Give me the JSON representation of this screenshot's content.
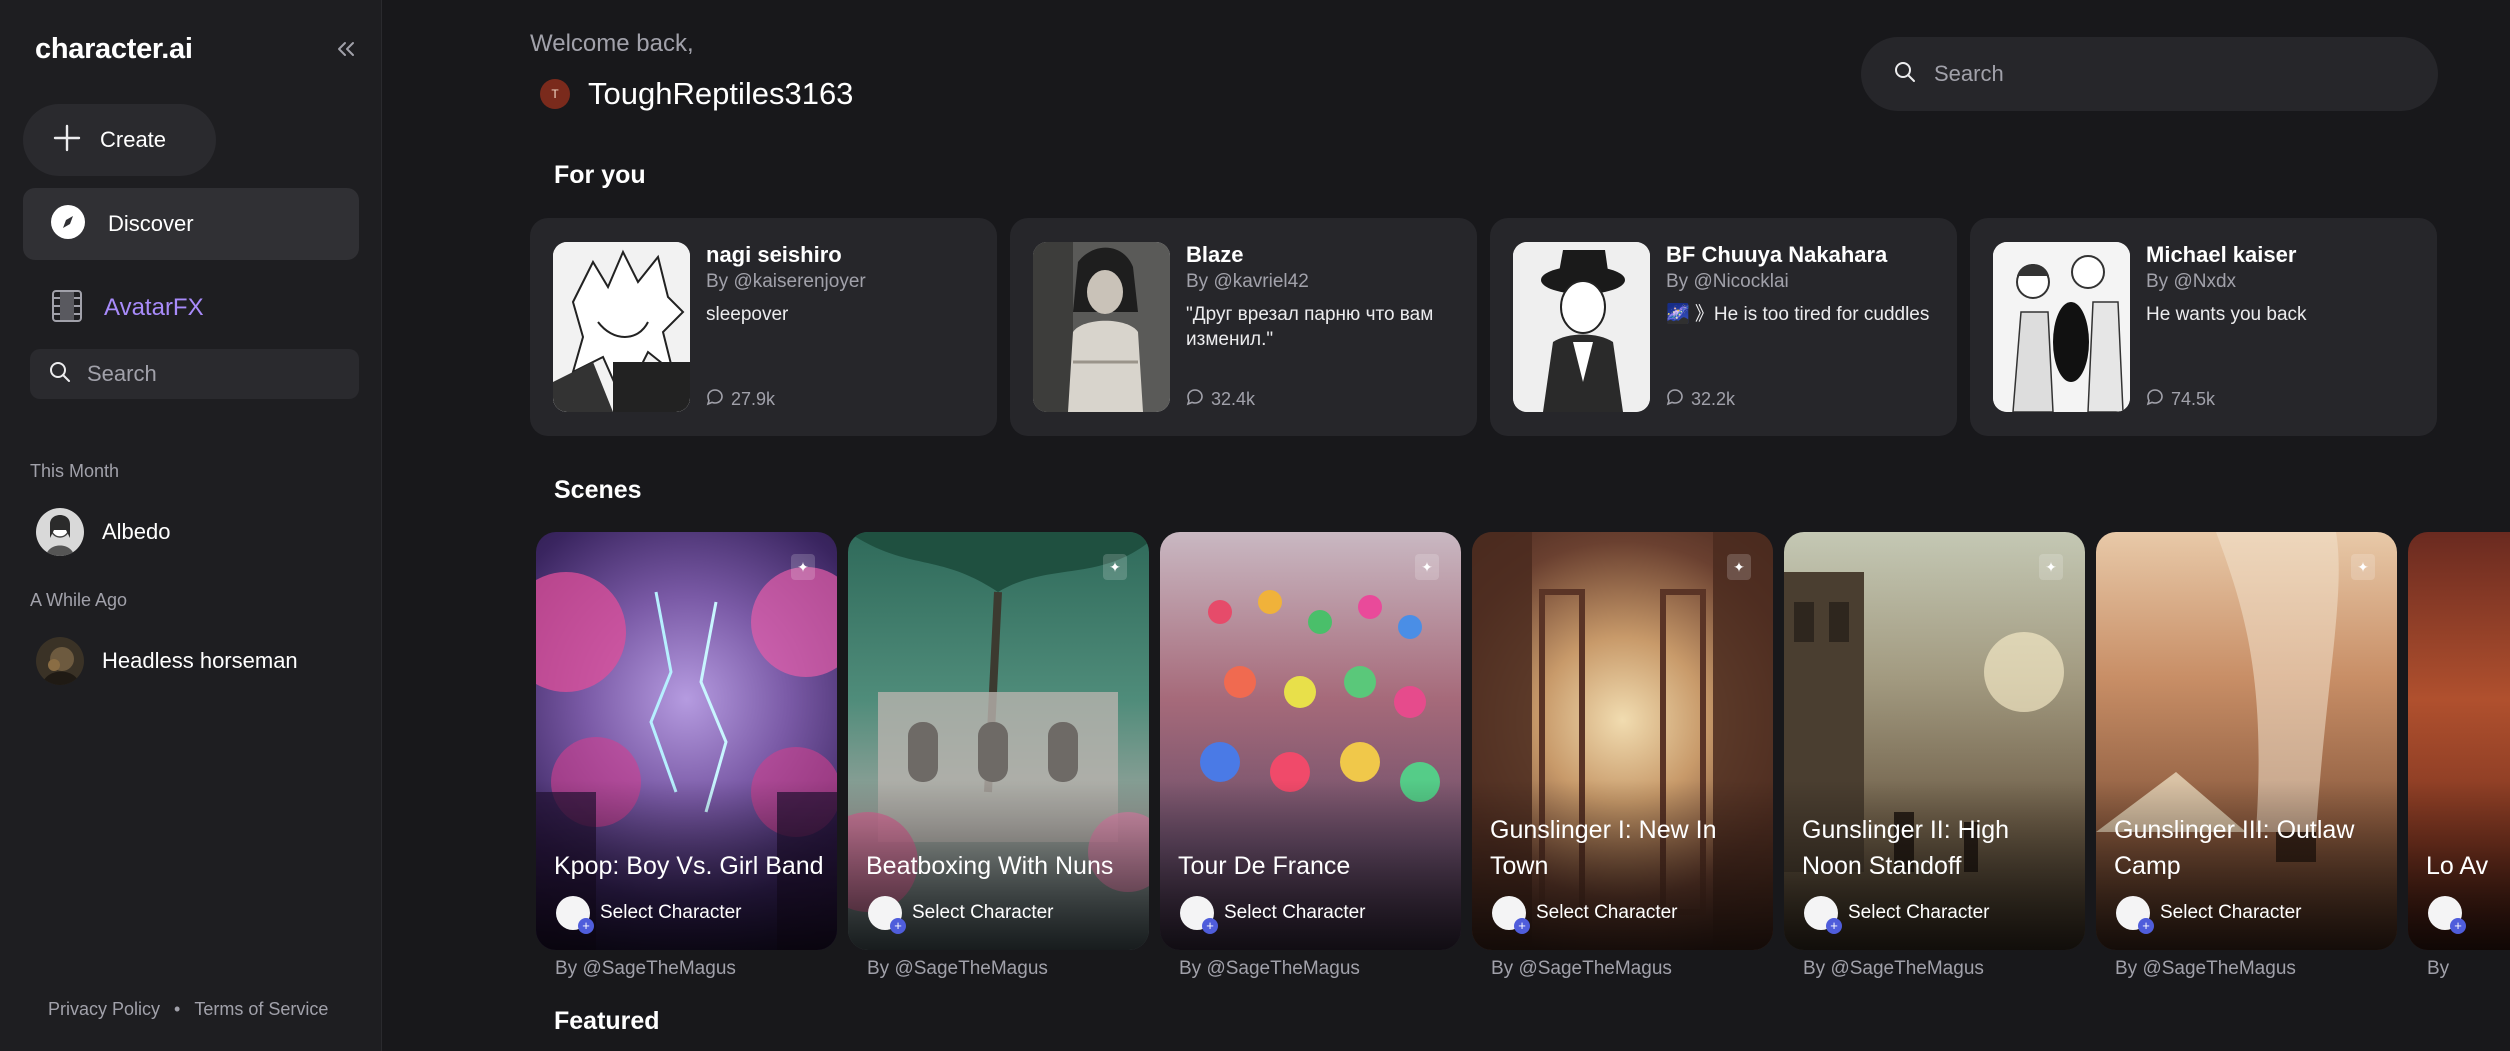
{
  "sidebar": {
    "logo": "character.ai",
    "create_label": "Create",
    "discover_label": "Discover",
    "avatarfx_label": "AvatarFX",
    "search_placeholder": "Search",
    "this_month_label": "This Month",
    "a_while_ago_label": "A While Ago",
    "chats_this_month": [
      {
        "name": "Albedo"
      }
    ],
    "chats_while_ago": [
      {
        "name": "Headless horseman"
      }
    ],
    "privacy_label": "Privacy Policy",
    "separator": "•",
    "terms_label": "Terms of Service"
  },
  "header": {
    "welcome": "Welcome back,",
    "username": "ToughReptiles3163",
    "user_initial": "T",
    "search_placeholder": "Search"
  },
  "for_you": {
    "title": "For you",
    "cards": [
      {
        "name": "nagi seishiro",
        "by": "By @kaiserenjoyer",
        "desc": "sleepover",
        "count": "27.9k"
      },
      {
        "name": "Blaze",
        "by": "By @kavriel42",
        "desc": "\"Друг врезал парню что вам изменил.\"",
        "count": "32.4k"
      },
      {
        "name": "BF Chuuya Nakahara",
        "by": "By @Nicocklai",
        "desc": "🌌 》He is too tired for cuddles",
        "count": "32.2k"
      },
      {
        "name": "Michael kaiser",
        "by": "By @Nxdx",
        "desc": "He wants you back",
        "count": "74.5k"
      }
    ]
  },
  "scenes": {
    "title": "Scenes",
    "select_label": "Select Character",
    "items": [
      {
        "title": "Kpop: Boy Vs. Girl Band",
        "by": "By @SageTheMagus"
      },
      {
        "title": "Beatboxing With Nuns",
        "by": "By @SageTheMagus"
      },
      {
        "title": "Tour De France",
        "by": "By @SageTheMagus"
      },
      {
        "title": "Gunslinger I: New In Town",
        "by": "By @SageTheMagus"
      },
      {
        "title": "Gunslinger II: High Noon Standoff",
        "by": "By @SageTheMagus"
      },
      {
        "title": "Gunslinger III: Outlaw Camp",
        "by": "By @SageTheMagus"
      },
      {
        "title": "Lo Av",
        "by": "By"
      }
    ]
  },
  "featured": {
    "title": "Featured"
  },
  "colors": {
    "accent_purple": "#a88bfa",
    "background": "#18181b",
    "sidebar": "#1e1e21",
    "card": "#26262a"
  }
}
